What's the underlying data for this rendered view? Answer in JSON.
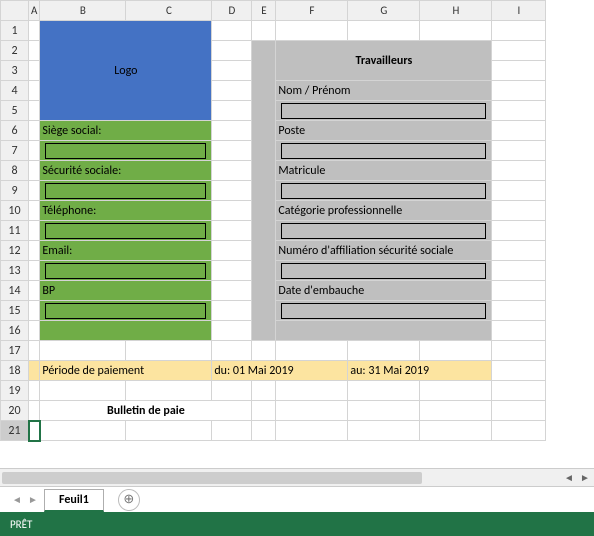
{
  "columns": [
    "A",
    "B",
    "C",
    "D",
    "E",
    "F",
    "G",
    "H",
    "I"
  ],
  "rows": [
    "1",
    "2",
    "3",
    "4",
    "5",
    "6",
    "7",
    "8",
    "9",
    "10",
    "11",
    "12",
    "13",
    "14",
    "15",
    "16",
    "17",
    "18",
    "19",
    "20",
    "21"
  ],
  "logo": {
    "text": "Logo"
  },
  "left_panel": {
    "labels": {
      "siege": "Siège social:",
      "securite": "Sécurité sociale:",
      "telephone": "Téléphone:",
      "email": "Email:",
      "bp": "BP"
    }
  },
  "right_panel": {
    "title": "Travailleurs",
    "labels": {
      "nom": "Nom / Prénom",
      "poste": "Poste",
      "matricule": "Matricule",
      "categorie": "Catégorie professionnelle",
      "affiliation": "Numéro d'affiliation sécurité sociale",
      "embauche": "Date d'embauche"
    }
  },
  "period_row": {
    "label": "Période de paiement",
    "from_label": "du:",
    "from_value": "01 Mai 2019",
    "to_label": "au:",
    "to_value": "31 Mai 2019"
  },
  "bulletin": {
    "title": "Bulletin de paie"
  },
  "sheet_tabs": {
    "active": "Feuil1"
  },
  "status": {
    "text": "PRÊT"
  },
  "icons": {
    "add_tab": "⊕",
    "nav_prev": "◄",
    "nav_next": "►",
    "scroll_left": "◄",
    "scroll_right": "►"
  },
  "active_cell": "A21"
}
